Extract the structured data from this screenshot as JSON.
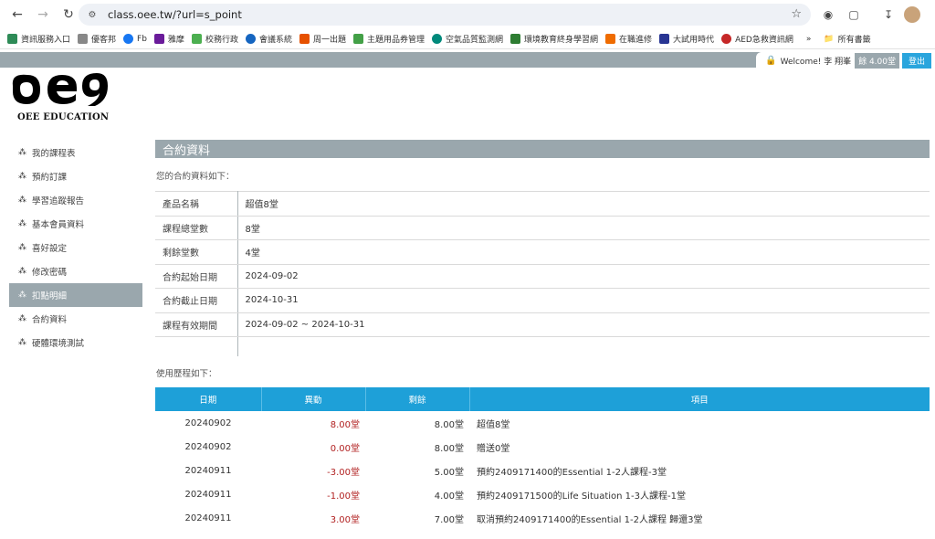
{
  "browser": {
    "url": "class.oee.tw/?url=s_point",
    "bookmarks": [
      "資訊服務入口",
      "優客邦",
      "Fb",
      "雅摩",
      "校務行政",
      "會議系統",
      "周一出題",
      "主題用品券管理",
      "空氣品質監測網",
      "環境教育終身學習網",
      "在職進修",
      "大試用時代",
      "AED急救資訊網"
    ],
    "bookmarks_more": "»",
    "all_bookmarks": "所有書籤"
  },
  "header": {
    "welcome": "Welcome! 李 翔峯",
    "points": "餘 4.00堂",
    "logout": "登出"
  },
  "logo": {
    "text": "OEE EDUCATION"
  },
  "sidebar": {
    "items": [
      {
        "label": "我的課程表"
      },
      {
        "label": "預約訂課"
      },
      {
        "label": "學習追蹤報告"
      },
      {
        "label": "基本會員資料"
      },
      {
        "label": "喜好設定"
      },
      {
        "label": "修改密碼"
      },
      {
        "label": "扣點明細"
      },
      {
        "label": "合約資料"
      },
      {
        "label": "硬體環境測試"
      }
    ],
    "active_index": 6
  },
  "main": {
    "title": "合約資料",
    "intro": "您的合約資料如下：",
    "contract": [
      {
        "k": "產品名稱",
        "v": "超值8堂"
      },
      {
        "k": "課程總堂數",
        "v": "8堂"
      },
      {
        "k": "剩餘堂數",
        "v": "4堂"
      },
      {
        "k": "合約起始日期",
        "v": "2024-09-02"
      },
      {
        "k": "合約截止日期",
        "v": "2024-10-31"
      },
      {
        "k": "課程有效期間",
        "v": "2024-09-02 ~ 2024-10-31"
      }
    ],
    "history_title": "使用歷程如下：",
    "history_headers": [
      "日期",
      "異動",
      "剩餘",
      "項目"
    ],
    "history": [
      {
        "date": "20240902",
        "change": "8.00堂",
        "balance": "8.00堂",
        "item": "超值8堂"
      },
      {
        "date": "20240902",
        "change": "0.00堂",
        "balance": "8.00堂",
        "item": "贈送0堂"
      },
      {
        "date": "20240911",
        "change": "-3.00堂",
        "balance": "5.00堂",
        "item": "預約2409171400的Essential 1-2人課程-3堂"
      },
      {
        "date": "20240911",
        "change": "-1.00堂",
        "balance": "4.00堂",
        "item": "預約2409171500的Life Situation 1-3人課程-1堂"
      },
      {
        "date": "20240911",
        "change": "3.00堂",
        "balance": "7.00堂",
        "item": "取消預約2409171400的Essential 1-2人課程 歸還3堂"
      }
    ]
  },
  "colors": {
    "accent_blue": "#1ea0d8",
    "gray_bar": "#9aa7ad",
    "change_red": "#b22222"
  }
}
